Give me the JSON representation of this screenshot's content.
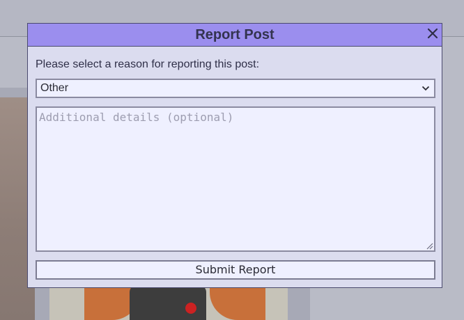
{
  "modal": {
    "title": "Report Post",
    "close_icon": "close-icon",
    "reason_label": "Please select a reason for reporting this post:",
    "reason_select": {
      "selected": "Other",
      "icon": "chevron-down-icon"
    },
    "details": {
      "placeholder": "Additional details (optional)",
      "value": ""
    },
    "submit_label": "Submit Report"
  },
  "colors": {
    "header_bg": "#9b8eee",
    "modal_bg": "#dbdcef",
    "field_bg": "#eff0ff",
    "overlay": "#b3b6c2"
  }
}
